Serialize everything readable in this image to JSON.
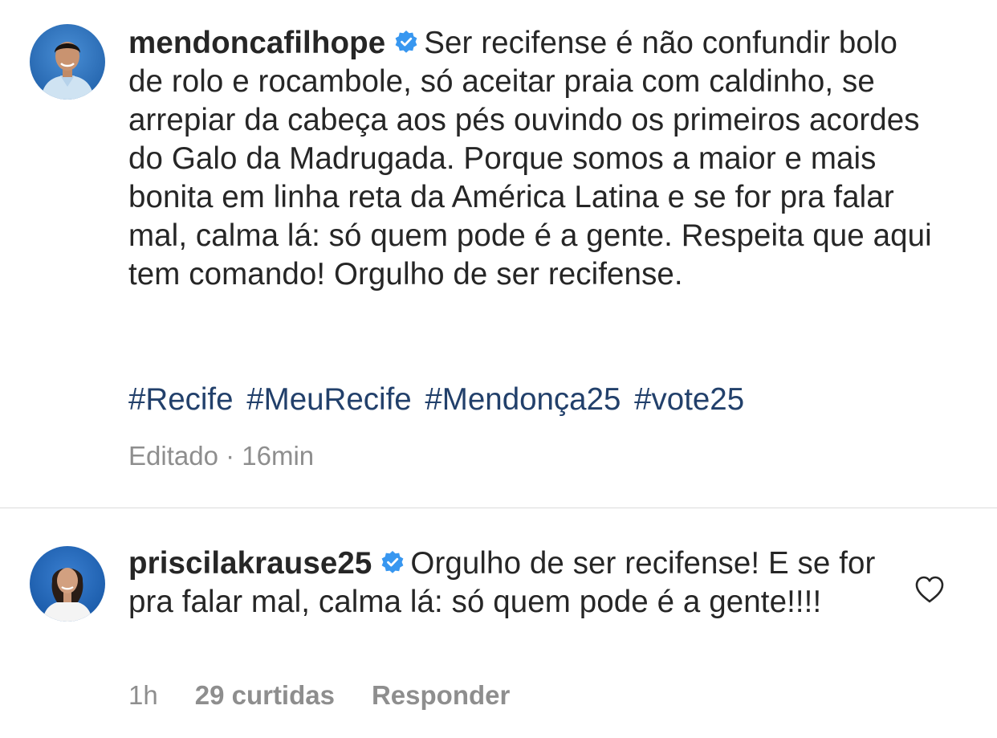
{
  "post": {
    "username": "mendoncafilhope",
    "verified_icon": "verified-badge-icon",
    "caption": "Ser recifense é não confundir bolo de rolo e rocambole, só aceitar praia com caldinho, se arrepiar da cabeça aos pés ouvindo os primeiros acordes do Galo da Madrugada. Porque somos a maior e mais bonita em linha reta da América Latina e se for pra falar mal, calma lá: só quem pode é a gente. Respeita que aqui tem comando! Orgulho de ser recifense.",
    "hashtags": [
      "#Recife",
      "#MeuRecife",
      "#Mendonça25",
      "#vote25"
    ],
    "edited_label": "Editado",
    "separator": "·",
    "time": "16min"
  },
  "comment": {
    "username": "priscilakrause25",
    "verified_icon": "verified-badge-icon",
    "text": "Orgulho de ser recifense! E se for pra falar mal, calma lá: só quem pode é a gente!!!!",
    "time": "1h",
    "likes_label": "29 curtidas",
    "reply_label": "Responder",
    "like_icon": "heart-outline-icon"
  },
  "colors": {
    "text": "#262626",
    "muted": "#8e8e8e",
    "hashtag": "#22406b",
    "verified": "#3897f0",
    "divider": "#dbdbdb"
  }
}
